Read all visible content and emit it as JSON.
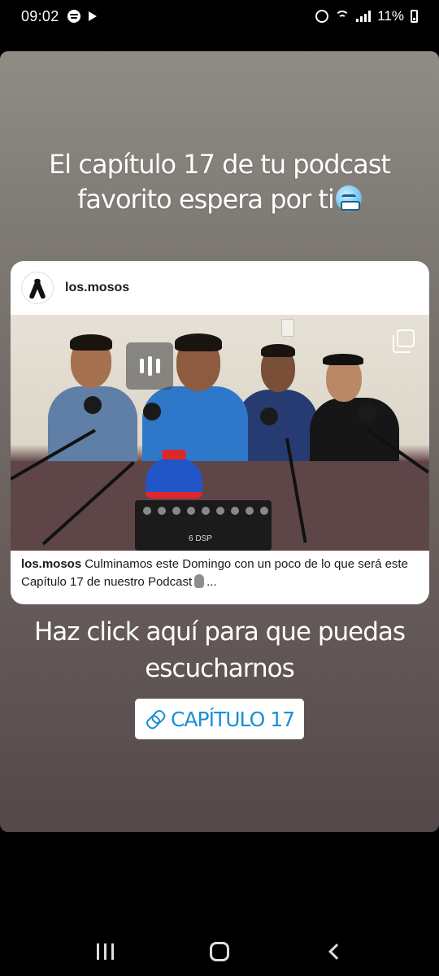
{
  "status_bar": {
    "time": "09:02",
    "battery": "11%",
    "icons": [
      "spotify-icon",
      "play-icon",
      "alarm-icon",
      "wifi-icon",
      "signal-icon",
      "battery-icon"
    ]
  },
  "story": {
    "heading_line1": "El capítulo 17 de tu podcast",
    "heading_line2": "favorito espera por ti",
    "heading_emoji": "freezing-face-emoji",
    "post": {
      "username": "los.mosos",
      "avatar_icon": "black-ribbon-icon",
      "media_overlay_icons": [
        "reel-icon",
        "carousel-icon"
      ],
      "mixer_label": "6 DSP",
      "caption_user": "los.mosos",
      "caption_line1": "Culminamos este Domingo con un poco de lo",
      "caption_line2": "que será este Capítulo 17 de nuestro Podcast",
      "caption_ellipsis": "..."
    },
    "cta_line1": "Haz click aquí para que puedas",
    "cta_line2": "escucharnos",
    "link_sticker": {
      "label": "CAPÍTULO 17",
      "icon": "link-icon",
      "color": "#1c8fd6"
    }
  },
  "nav_bar": {
    "buttons": [
      "recent-apps-button",
      "home-button",
      "back-button"
    ]
  }
}
